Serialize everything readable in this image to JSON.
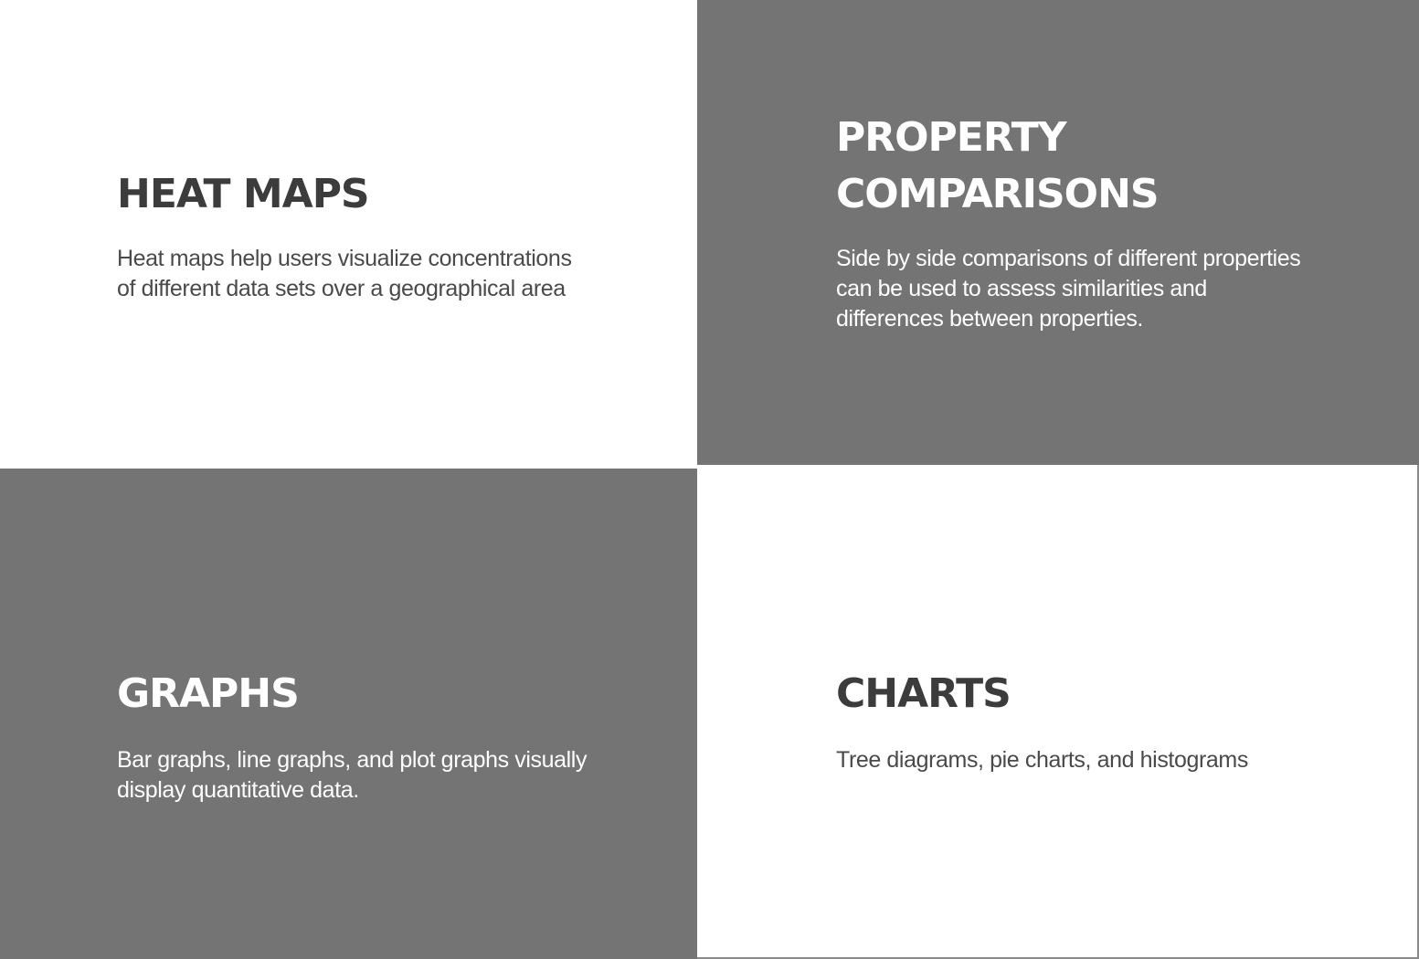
{
  "panels": {
    "heat_maps": {
      "title": "HEAT MAPS",
      "description": "Heat maps help users visualize concentrations of different data sets over a geographical area"
    },
    "property_comparisons": {
      "title": "PROPERTY COMPARISONS",
      "description": "Side by side comparisons of different properties can be used to assess similarities and differences between properties."
    },
    "graphs": {
      "title": "GRAPHS",
      "description": "Bar graphs, line graphs, and plot graphs visually display quantitative data."
    },
    "charts": {
      "title": "CHARTS",
      "description": "Tree diagrams, pie charts, and histograms"
    }
  },
  "colors": {
    "dark_panel": "#747474",
    "light_panel": "#ffffff",
    "dark_text": "#3c3c3c",
    "light_text": "#ffffff"
  }
}
